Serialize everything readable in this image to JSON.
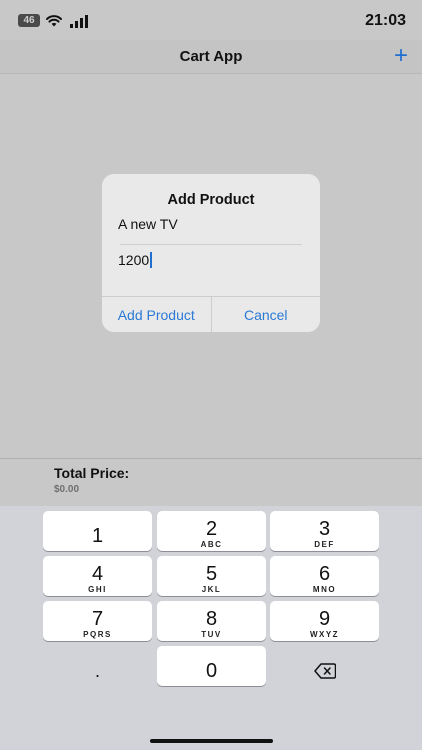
{
  "status_bar": {
    "battery": "46",
    "time": "21:03"
  },
  "nav": {
    "title": "Cart App",
    "add_icon": "plus-icon"
  },
  "dialog": {
    "title": "Add Product",
    "name_value": "A new TV",
    "price_value": "1200",
    "add_label": "Add Product",
    "cancel_label": "Cancel"
  },
  "total": {
    "label": "Total Price:",
    "value": "$0.00"
  },
  "keyboard": {
    "keys": [
      {
        "digit": "1",
        "letters": ""
      },
      {
        "digit": "2",
        "letters": "ABC"
      },
      {
        "digit": "3",
        "letters": "DEF"
      },
      {
        "digit": "4",
        "letters": "GHI"
      },
      {
        "digit": "5",
        "letters": "JKL"
      },
      {
        "digit": "6",
        "letters": "MNO"
      },
      {
        "digit": "7",
        "letters": "PQRS"
      },
      {
        "digit": "8",
        "letters": "TUV"
      },
      {
        "digit": "9",
        "letters": "WXYZ"
      },
      {
        "digit": ".",
        "letters": ""
      },
      {
        "digit": "0",
        "letters": ""
      }
    ],
    "delete_icon": "backspace-icon"
  },
  "colors": {
    "accent": "#1f6fcf",
    "background": "#c8c8c8",
    "keyboard": "#d1d3d9"
  }
}
